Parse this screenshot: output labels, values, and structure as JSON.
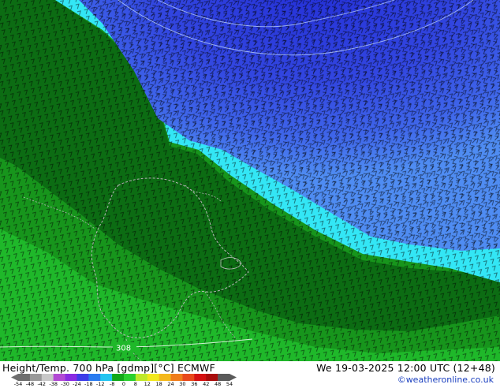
{
  "map": {
    "field_label": "Height/Temp. 700 hPa [gdmp][°C] ECMWF",
    "valid_time": "We 19-03-2025 12:00 UTC (12+48)",
    "credit": "©weatheronline.co.uk",
    "contour_label": "308",
    "colors": {
      "deep_blue": "#2430d8",
      "mid_blue": "#3f55e8",
      "light_blue": "#4f8cf2",
      "cyan": "#33e6f5",
      "dark_green": "#0b6e12",
      "green": "#17951c",
      "bright_green": "#1fb82a",
      "glyph": "#000000"
    },
    "colorbar": {
      "ticks": [
        "-54",
        "-48",
        "-42",
        "-38",
        "-30",
        "-24",
        "-18",
        "-12",
        "-8",
        "0",
        "8",
        "12",
        "18",
        "24",
        "30",
        "36",
        "42",
        "48",
        "54"
      ],
      "colors": [
        "#6e6e6e",
        "#9a9a9a",
        "#c8c8c8",
        "#b24ad4",
        "#8a2be2",
        "#3d3de8",
        "#2a7cf0",
        "#22c4f0",
        "#11a819",
        "#2ad02e",
        "#bfe82a",
        "#f2e81e",
        "#f4b81c",
        "#f07d1a",
        "#e8481a",
        "#d41010",
        "#a80c0c",
        "#5a5a5a"
      ]
    }
  }
}
